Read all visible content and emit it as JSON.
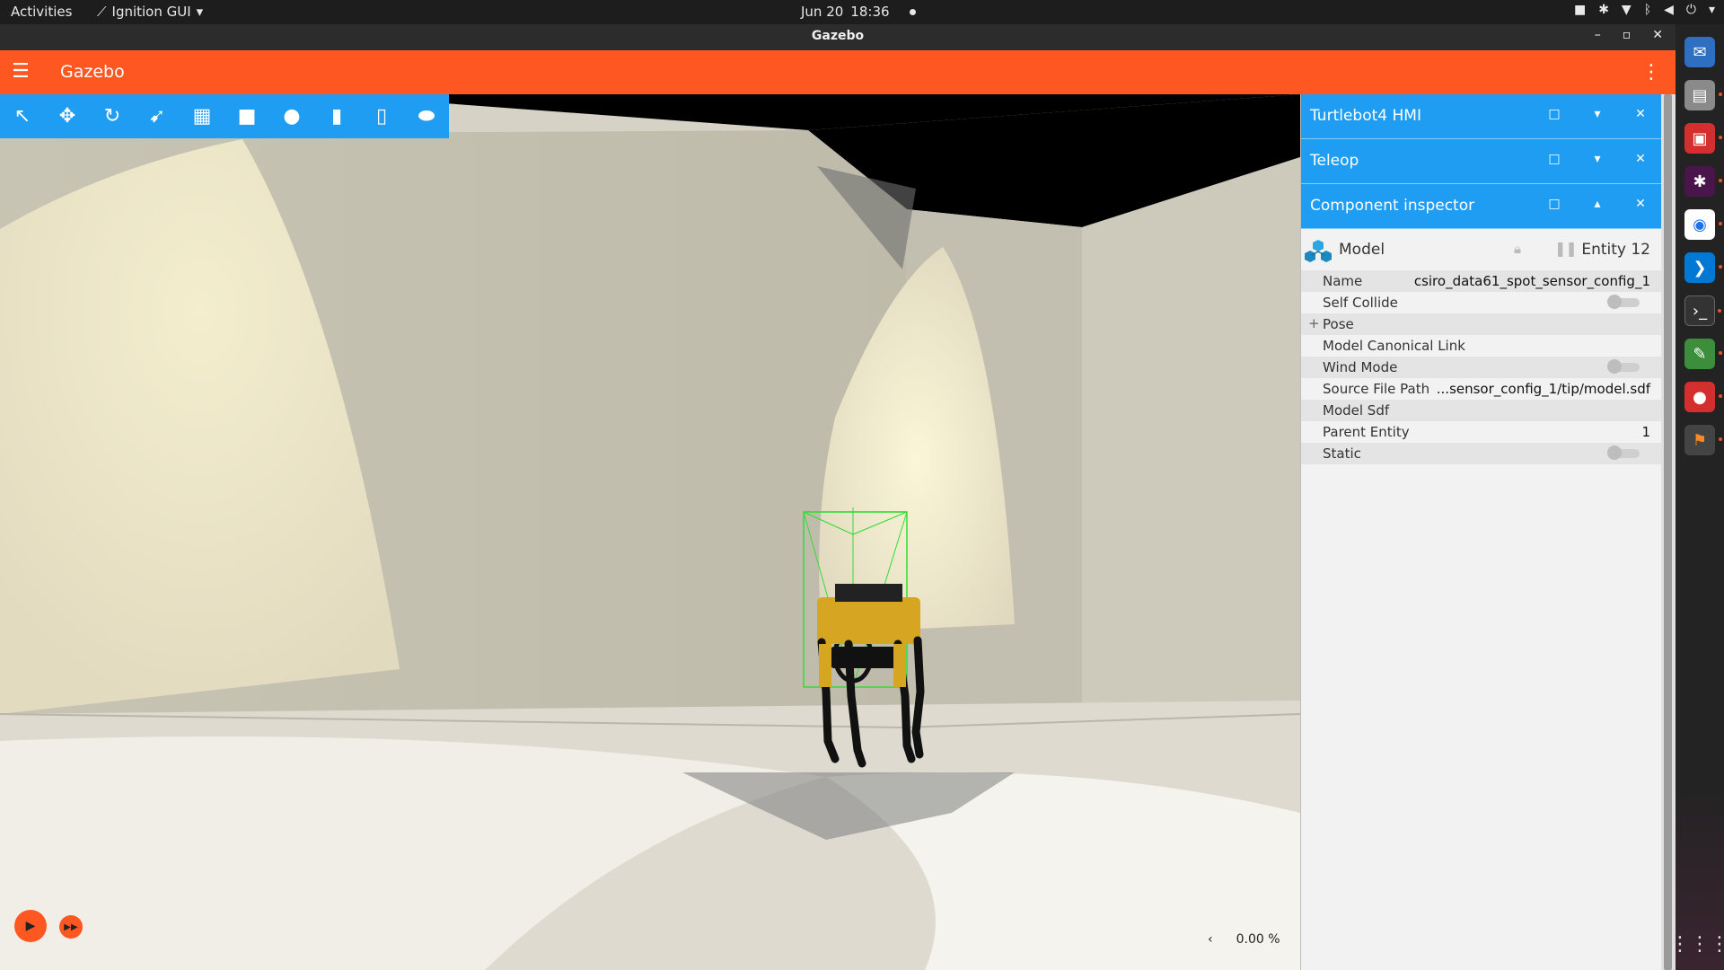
{
  "topbar": {
    "activities": "Activities",
    "app_name": "Ignition GUI",
    "date": "Jun 20",
    "time": "18:36"
  },
  "window": {
    "title": "Gazebo"
  },
  "appbar": {
    "title": "Gazebo"
  },
  "toolbar": {
    "tools": [
      "select-tool",
      "translate-tool",
      "rotate-tool",
      "transform-control",
      "grid-tool",
      "box-shape",
      "sphere-shape",
      "cylinder-shape",
      "capsule-shape",
      "ellipsoid-shape"
    ]
  },
  "panels": [
    {
      "title": "Turtlebot4 HMI",
      "expanded": false
    },
    {
      "title": "Teleop",
      "expanded": false
    },
    {
      "title": "Component inspector",
      "expanded": true
    }
  ],
  "inspector": {
    "type_label": "Model",
    "entity_label": "Entity 12",
    "rows": [
      {
        "key": "Name",
        "value": "csiro_data61_spot_sensor_config_1"
      },
      {
        "key": "Self Collide",
        "toggle": false
      },
      {
        "key": "Pose",
        "expandable": true
      },
      {
        "key": "Model Canonical Link",
        "value": ""
      },
      {
        "key": "Wind Mode",
        "toggle": false
      },
      {
        "key": "Source File Path",
        "value": "...sensor_config_1/tip/model.sdf"
      },
      {
        "key": "Model Sdf",
        "value": ""
      },
      {
        "key": "Parent Entity",
        "value": "1"
      },
      {
        "key": "Static",
        "toggle": false
      }
    ]
  },
  "playback": {
    "rtf": "0.00 %",
    "collapse_glyph": "‹"
  },
  "colors": {
    "accent": "#fe5722",
    "panel_header": "#1e9df2",
    "toolbar": "#1e9df2"
  }
}
